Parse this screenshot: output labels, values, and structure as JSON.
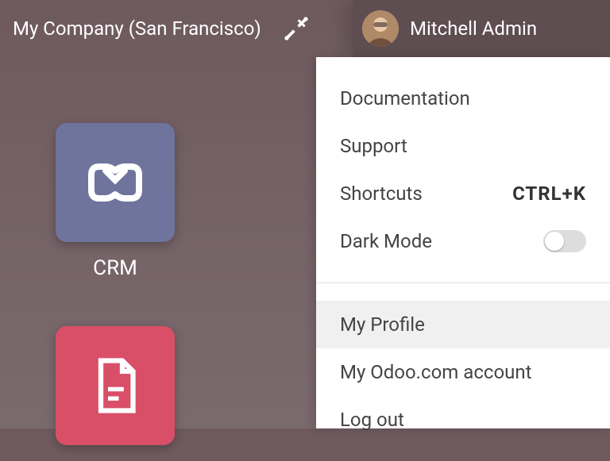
{
  "header": {
    "company": "My Company (San Francisco)",
    "username": "Mitchell Admin"
  },
  "apps": {
    "crm_label": "CRM"
  },
  "menu": {
    "documentation": "Documentation",
    "support": "Support",
    "shortcuts_label": "Shortcuts",
    "shortcuts_key": "CTRL+K",
    "dark_mode": "Dark Mode",
    "my_profile": "My Profile",
    "odoo_account": "My Odoo.com account",
    "log_out": "Log out"
  }
}
